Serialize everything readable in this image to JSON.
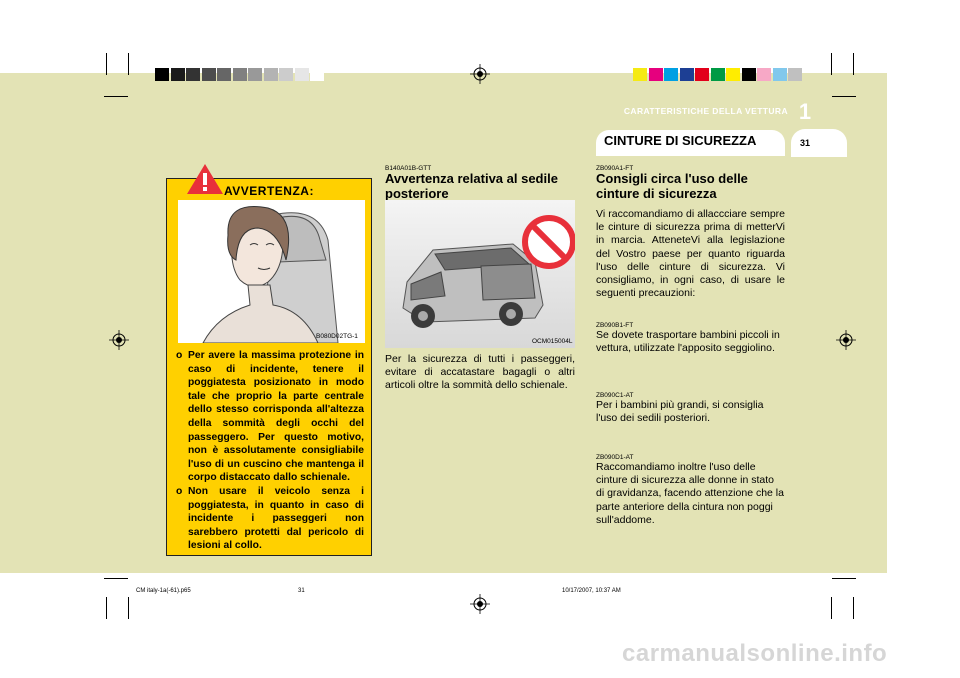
{
  "print_marks": {
    "grayscale_swatches": [
      "#000000",
      "#1a1a1a",
      "#333333",
      "#4d4d4d",
      "#666666",
      "#808080",
      "#999999",
      "#b3b3b3",
      "#cccccc",
      "#e6e6e6",
      "#ffffff"
    ],
    "color_swatches": [
      "#f5ea14",
      "#e6007e",
      "#00a0e3",
      "#1d3f94",
      "#e2001a",
      "#009a44",
      "#ffed00",
      "#000000",
      "#f7a8c6",
      "#81c8ec",
      "#c0c0c0"
    ]
  },
  "header": {
    "section_label": "CARATTERISTICHE DELLA VETTURA",
    "chapter_number": "1",
    "tab_title": "CINTURE DI SICUREZZA",
    "page_number": "31"
  },
  "warning": {
    "title": "AVVERTENZA:",
    "image_code": "B080D02TG-1",
    "items": [
      {
        "bullet": "o",
        "text": "Per avere la massima protezione in caso di incidente, tenere il poggiatesta posizionato in modo tale che proprio la parte centrale dello stesso corrisponda all'altezza della sommità degli occhi del passeggero. Per questo motivo, non è assolutamente consigliabile l'uso di un cuscino che mantenga il corpo distaccato dallo schienale."
      },
      {
        "bullet": "o",
        "text": "Non usare il veicolo senza i poggiatesta, in quanto in caso di incidente i passeggeri non sarebbero protetti dal pericolo di lesioni al collo."
      }
    ]
  },
  "middle": {
    "code": "B140A01B-GTT",
    "heading": "Avvertenza relativa al sedile posteriore",
    "image_code": "OCM015004L",
    "body": "Per la sicurezza di tutti i passeggeri, evitare di accatastare bagagli o altri articoli oltre la sommità dello schienale."
  },
  "right": {
    "code1": "ZB090A1-FT",
    "heading": "Consigli circa l'uso delle cinture di sicurezza",
    "body1": "Vi raccomandiamo di allaccciare sempre le cinture di sicurezza prima di metterVi in marcia. AtteneteVi alla legislazione del Vostro paese per quanto riguarda l'uso delle cinture di sicurezza. Vi consigliamo, in ogni caso, di usare le seguenti precauzioni:",
    "code2": "ZB090B1-FT",
    "body2": "Se dovete trasportare bambini piccoli in vettura, utilizzate l'apposito seggiolino.",
    "code3": "ZB090C1-AT",
    "body3": "Per i bambini più grandi, si consiglia l'uso dei sedili posteriori.",
    "code4": "ZB090D1-AT",
    "body4": "Raccomandiamo inoltre l'uso delle cinture di sicurezza alle donne in stato di gravidanza, facendo attenzione che la parte anteriore della cintura non poggi sull'addome."
  },
  "footer": {
    "file": "CM italy-1a(-61).p65",
    "page": "31",
    "timestamp": "10/17/2007, 10:37 AM"
  },
  "watermark": "carmanualsonline.info",
  "colors": {
    "band": "#e3e3b5",
    "warning_yellow": "#ffd000",
    "prohibition_red": "#e8303a"
  }
}
